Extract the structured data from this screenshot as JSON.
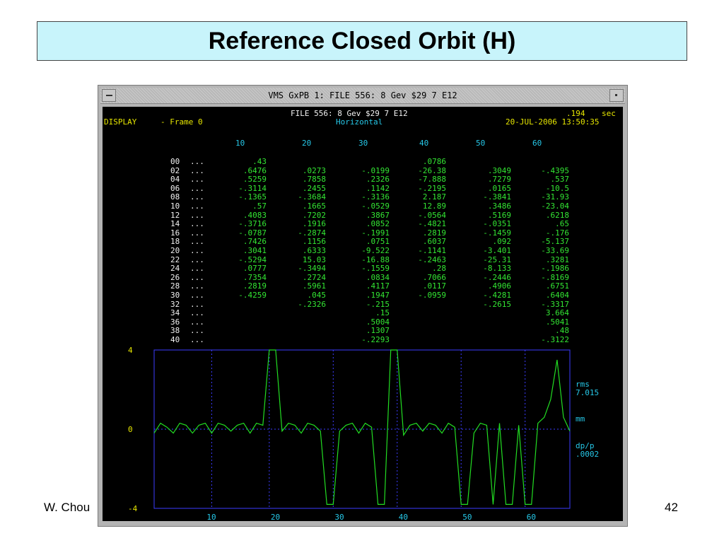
{
  "slide": {
    "title": "Reference Closed Orbit (H)",
    "author": "W. Chou",
    "page": "42"
  },
  "window": {
    "title": "VMS GxPB 1: FILE 556: 8 Gev $29 7 E12"
  },
  "header": {
    "file": "FILE 556: 8 Gev $29 7 E12",
    "plane": "Horizontal",
    "display": "DISPLAY",
    "frame": "- Frame 0",
    "time_value": ".194",
    "time_unit": "sec",
    "datetime": "20-JUL-2006 13:50:35"
  },
  "table": {
    "columns": [
      "10",
      "20",
      "30",
      "40",
      "50",
      "60"
    ],
    "dots": "...",
    "rows": [
      {
        "idx": "00",
        "v": [
          ".43",
          "",
          "",
          ".0786",
          "",
          ""
        ]
      },
      {
        "idx": "02",
        "v": [
          ".6476",
          ".0273",
          "-.0199",
          "-26.38",
          ".3049",
          "-.4395"
        ]
      },
      {
        "idx": "04",
        "v": [
          ".5259",
          ".7858",
          ".2326",
          "-7.888",
          ".7279",
          ".537"
        ]
      },
      {
        "idx": "06",
        "v": [
          "-.3114",
          ".2455",
          ".1142",
          "-.2195",
          ".0165",
          "-10.5"
        ]
      },
      {
        "idx": "08",
        "v": [
          "-.1365",
          "-.3684",
          "-.3136",
          "2.187",
          "-.3841",
          "-31.93"
        ]
      },
      {
        "idx": "10",
        "v": [
          ".57",
          ".1665",
          "-.0529",
          "12.89",
          ".3486",
          "-23.04"
        ]
      },
      {
        "idx": "12",
        "v": [
          ".4083",
          ".7202",
          ".3867",
          "-.0564",
          ".5169",
          ".6218"
        ]
      },
      {
        "idx": "14",
        "v": [
          "-.3716",
          ".1916",
          ".0852",
          "-.4821",
          "-.0351",
          ".65"
        ]
      },
      {
        "idx": "16",
        "v": [
          "-.0787",
          "-.2874",
          "-.1991",
          ".2819",
          "-.1459",
          "-.176"
        ]
      },
      {
        "idx": "18",
        "v": [
          ".7426",
          ".1156",
          ".0751",
          ".6037",
          ".092",
          "-5.137"
        ]
      },
      {
        "idx": "20",
        "v": [
          ".3041",
          ".6333",
          "-9.522",
          "-.1141",
          "-3.401",
          "-33.69"
        ]
      },
      {
        "idx": "22",
        "v": [
          "-.5294",
          "15.03",
          "-16.88",
          "-.2463",
          "-25.31",
          ".3281"
        ]
      },
      {
        "idx": "24",
        "v": [
          ".0777",
          "-.3494",
          "-.1559",
          ".28",
          "-8.133",
          "-.1986"
        ]
      },
      {
        "idx": "26",
        "v": [
          ".7354",
          ".2724",
          ".0834",
          ".7066",
          "-.2446",
          "-.8169"
        ]
      },
      {
        "idx": "28",
        "v": [
          ".2819",
          ".5961",
          ".4117",
          ".0117",
          ".4906",
          ".6751"
        ]
      },
      {
        "idx": "30",
        "v": [
          "-.4259",
          ".045",
          ".1947",
          "-.0959",
          "-.4281",
          ".6404"
        ]
      },
      {
        "idx": "32",
        "v": [
          "",
          "-.2326",
          "-.215",
          "",
          "-.2615",
          "-.3317"
        ]
      },
      {
        "idx": "34",
        "v": [
          "",
          "",
          ".15",
          "",
          "",
          "3.664"
        ]
      },
      {
        "idx": "36",
        "v": [
          "",
          "",
          ".5004",
          "",
          "",
          ".5041"
        ]
      },
      {
        "idx": "38",
        "v": [
          "",
          "",
          ".1307",
          "",
          "",
          ".48"
        ]
      },
      {
        "idx": "40",
        "v": [
          "",
          "",
          "-.2293",
          "",
          "",
          "-.3122"
        ]
      }
    ]
  },
  "chart_data": {
    "type": "line",
    "ylim": [
      -4,
      4
    ],
    "xlim": [
      1,
      66
    ],
    "y_ticks": [
      "4",
      "0",
      "-4"
    ],
    "x_ticks": [
      "10",
      "20",
      "30",
      "40",
      "50",
      "60"
    ],
    "x_tick_values": [
      10,
      20,
      30,
      40,
      50,
      60
    ],
    "grid_x": [
      10,
      19,
      29,
      39,
      49,
      59
    ],
    "grid": true,
    "legend": {
      "rms_label": "rms",
      "rms_value": "7.015",
      "unit": "mm",
      "dp_label": "dp/p",
      "dp_value": ".0002"
    },
    "colors": {
      "frame": "#3c3cff",
      "grid": "#3c3cff",
      "trace": "#22dd22"
    },
    "series": [
      {
        "values": [
          -0.2,
          0.3,
          0.1,
          -0.2,
          0.3,
          0.2,
          -0.2,
          0.2,
          0.3,
          -0.2,
          0.3,
          0.2,
          -0.1,
          0.2,
          0.3,
          -0.2,
          0.3,
          0.2,
          4,
          4,
          -0.1,
          0.3,
          0.2,
          -0.2,
          0.3,
          0.2,
          -0.1,
          -3.8,
          -3.8,
          -0.1,
          0.2,
          0.3,
          -0.2,
          0.3,
          0.1,
          -3.8,
          -3.8,
          4,
          4,
          -0.3,
          0.2,
          0.3,
          -0.1,
          0.3,
          0.2,
          -0.2,
          0.3,
          0.1,
          -3.8,
          -3.8,
          -0.2,
          0.3,
          0.2,
          -3.8,
          0.3,
          -3.8,
          -3.8,
          0.2,
          -3.8,
          -3.8,
          0.3,
          0.6,
          1.5,
          3.5,
          0.6,
          -0.1
        ]
      }
    ]
  }
}
